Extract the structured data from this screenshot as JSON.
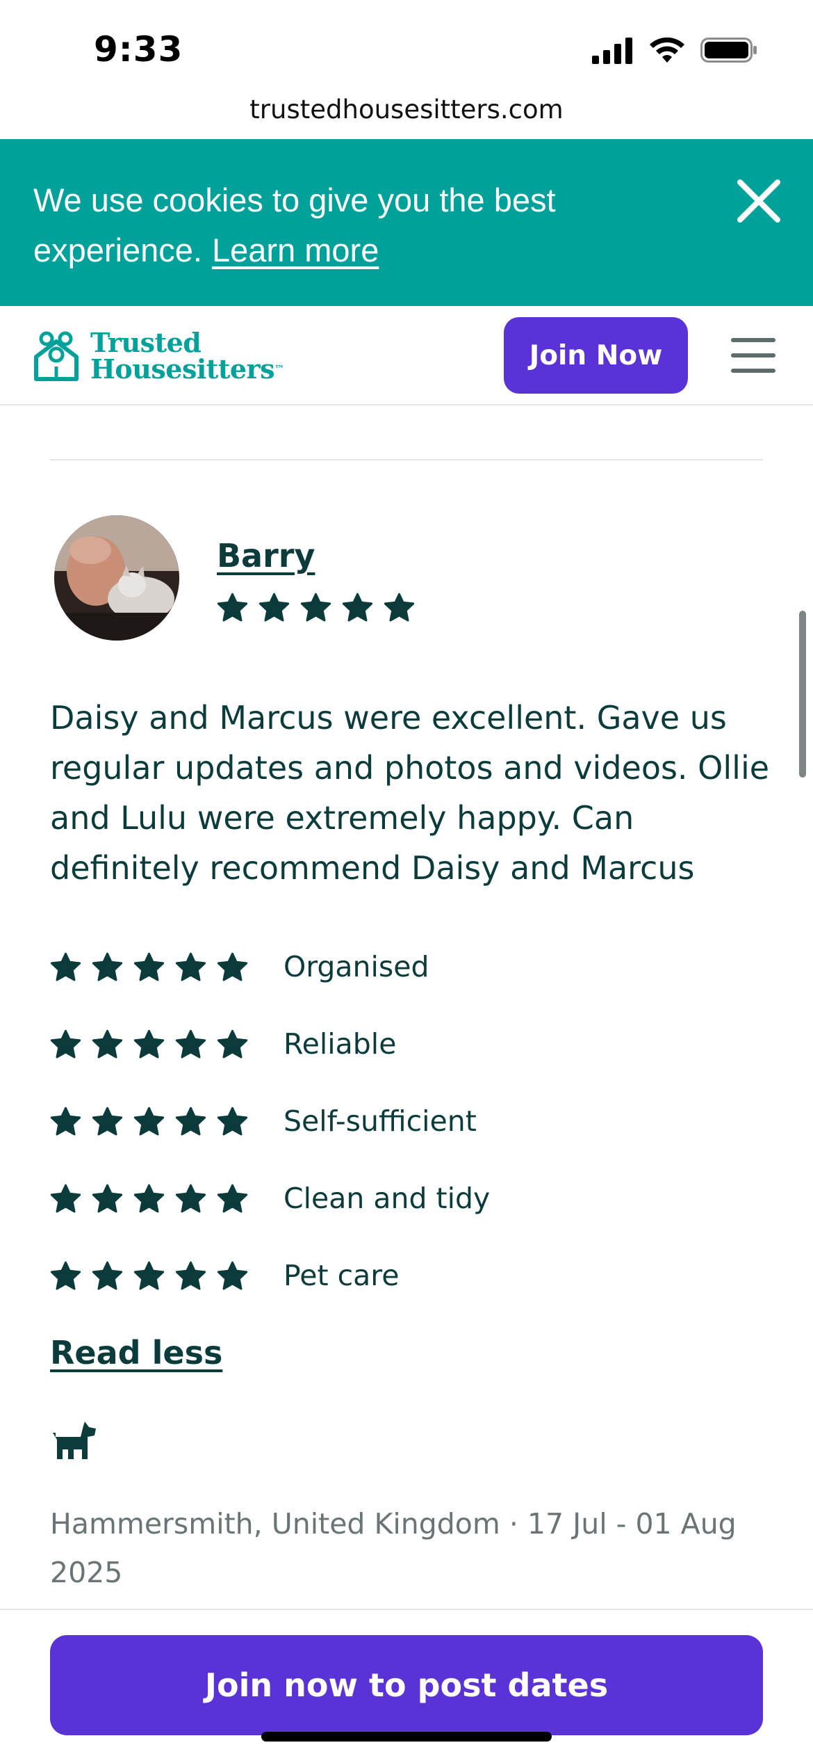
{
  "status_bar": {
    "time": "9:33",
    "icons": [
      "signal-icon",
      "wifi-icon",
      "battery-icon"
    ]
  },
  "browser": {
    "url": "trustedhousesitters.com"
  },
  "cookie_banner": {
    "text": "We use cookies to give you the best experience.",
    "link": "Learn more",
    "close_icon": "close-icon",
    "background": "#00a19a"
  },
  "header": {
    "logo_line1": "Trusted",
    "logo_line2": "Housesitters",
    "logo_tm": "™",
    "join_button": "Join Now",
    "menu_icon": "hamburger-menu-icon",
    "accent": "#5a33d6",
    "brand": "#00a19a"
  },
  "review": {
    "reviewer_name": "Barry",
    "overall_rating": 5,
    "text": "Daisy and Marcus were excellent. Gave us regular updates and photos and videos. Ollie and Lulu were extremely happy. Can definitely recommend Daisy and Marcus",
    "categories": [
      {
        "label": "Organised",
        "rating": 5
      },
      {
        "label": "Reliable",
        "rating": 5
      },
      {
        "label": "Self-sufficient",
        "rating": 5
      },
      {
        "label": "Clean and tidy",
        "rating": 5
      },
      {
        "label": "Pet care",
        "rating": 5
      }
    ],
    "read_less": "Read less",
    "pet_icon": "dog-icon",
    "meta": "Hammersmith, United Kingdom · 17 Jul - 01 Aug 2025"
  },
  "bottom": {
    "cta": "Join now to post dates"
  }
}
